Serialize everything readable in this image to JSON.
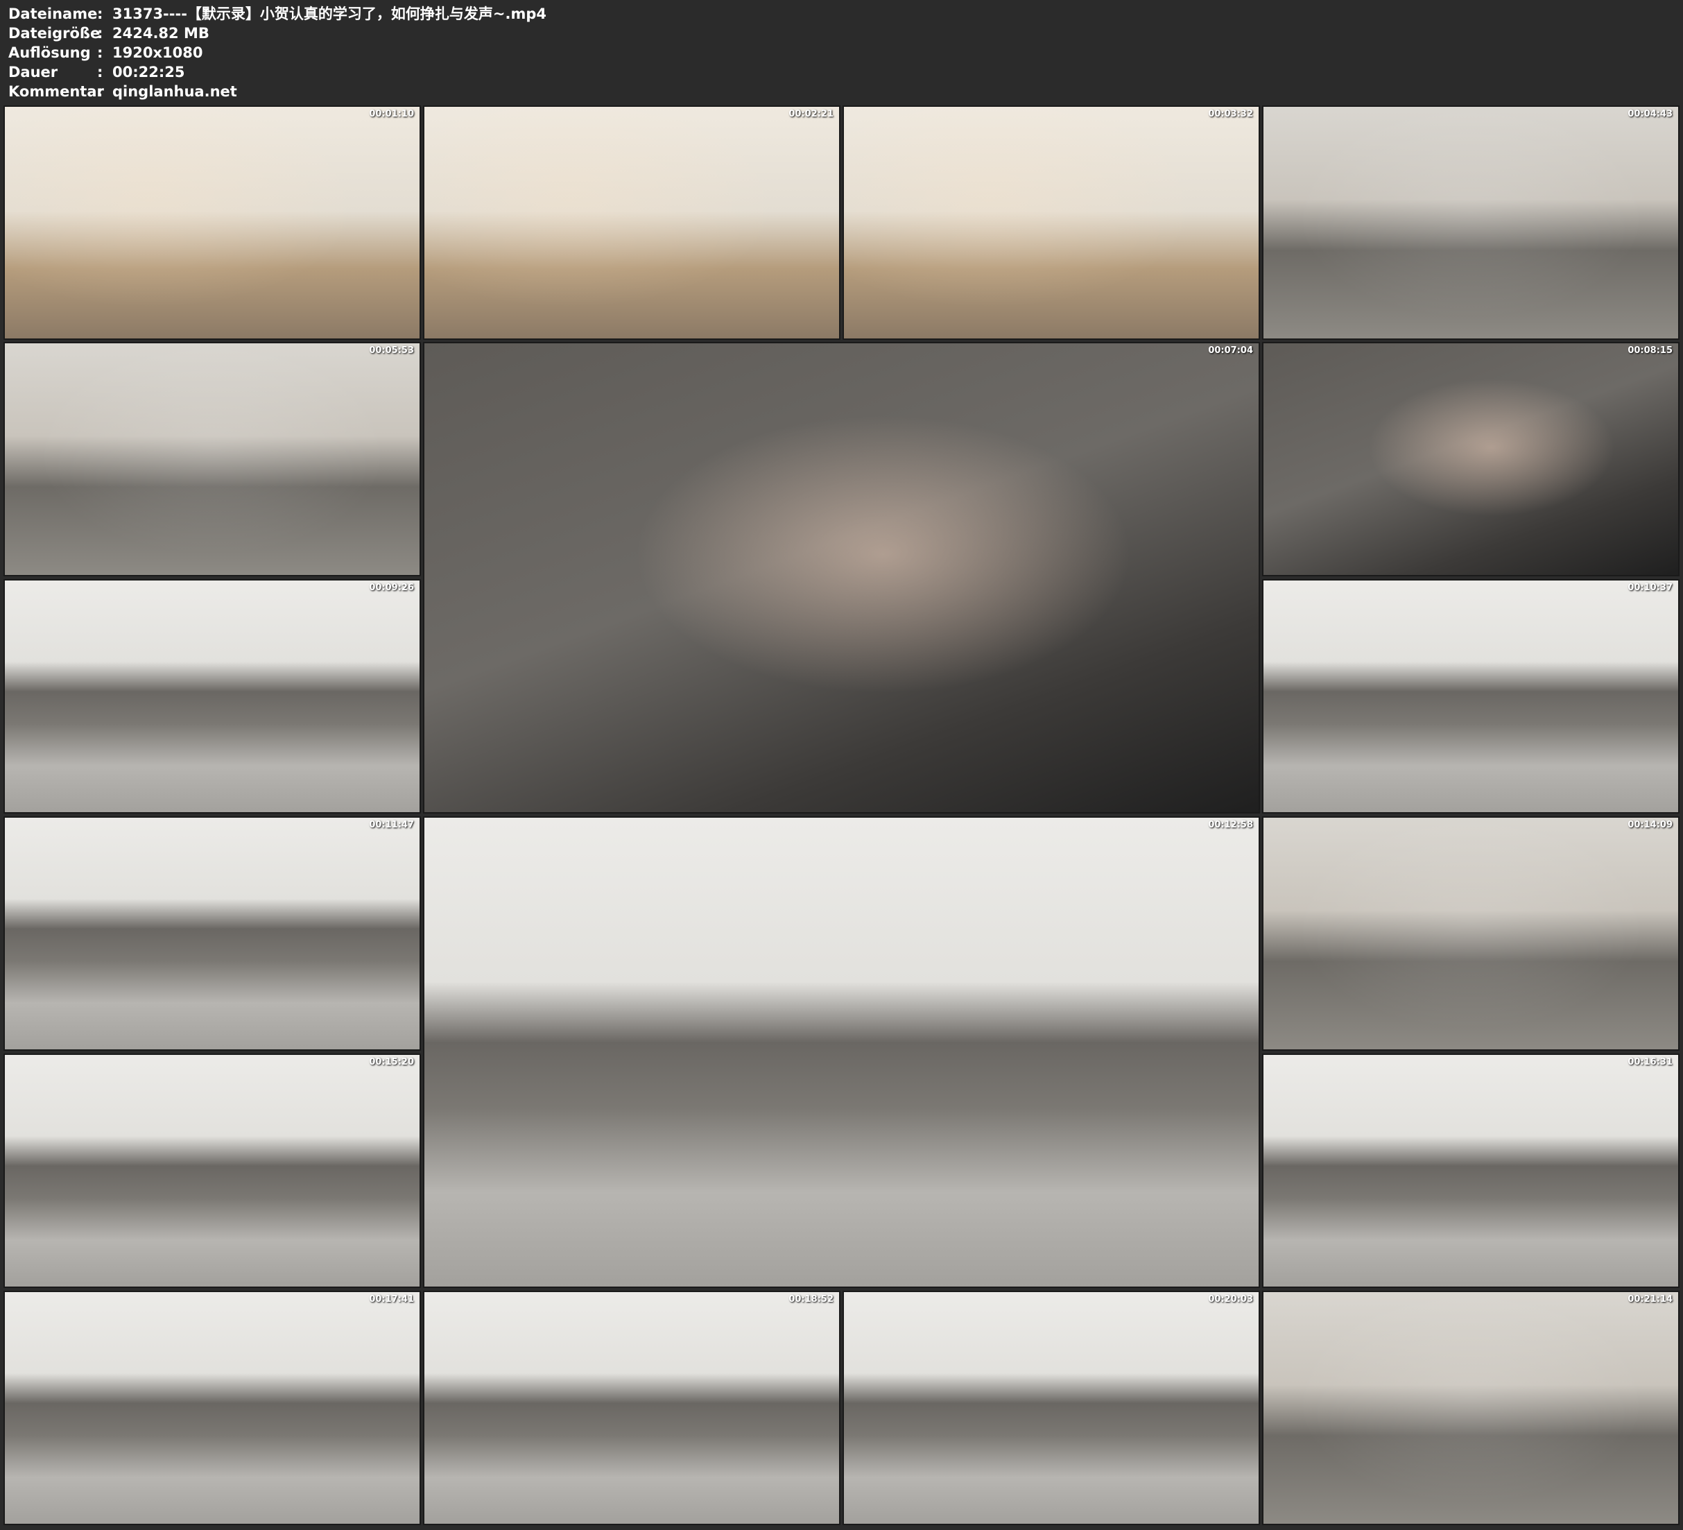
{
  "header": {
    "rows": [
      {
        "label": "Dateiname",
        "value": "31373----【默示录】小贺认真的学习了，如何挣扎与发声~.mp4"
      },
      {
        "label": "Dateigröße",
        "value": "2424.82 MB"
      },
      {
        "label": "Auflösung",
        "value": "1920x1080"
      },
      {
        "label": "Dauer",
        "value": "00:22:25"
      },
      {
        "label": "Kommentar",
        "value": "qinglanhua.net"
      }
    ],
    "separator": ":"
  },
  "thumbnails": [
    {
      "timestamp": "00:01:10"
    },
    {
      "timestamp": "00:02:21"
    },
    {
      "timestamp": "00:03:32"
    },
    {
      "timestamp": "00:04:43"
    },
    {
      "timestamp": "00:05:53"
    },
    {
      "timestamp": "00:07:04"
    },
    {
      "timestamp": "00:08:15"
    },
    {
      "timestamp": "00:09:26"
    },
    {
      "timestamp": "00:10:37"
    },
    {
      "timestamp": "00:11:47"
    },
    {
      "timestamp": "00:12:58"
    },
    {
      "timestamp": "00:14:09"
    },
    {
      "timestamp": "00:15:20"
    },
    {
      "timestamp": "00:16:31"
    },
    {
      "timestamp": "00:17:41"
    },
    {
      "timestamp": "00:18:52"
    },
    {
      "timestamp": "00:20:03"
    },
    {
      "timestamp": "00:21:14"
    }
  ]
}
